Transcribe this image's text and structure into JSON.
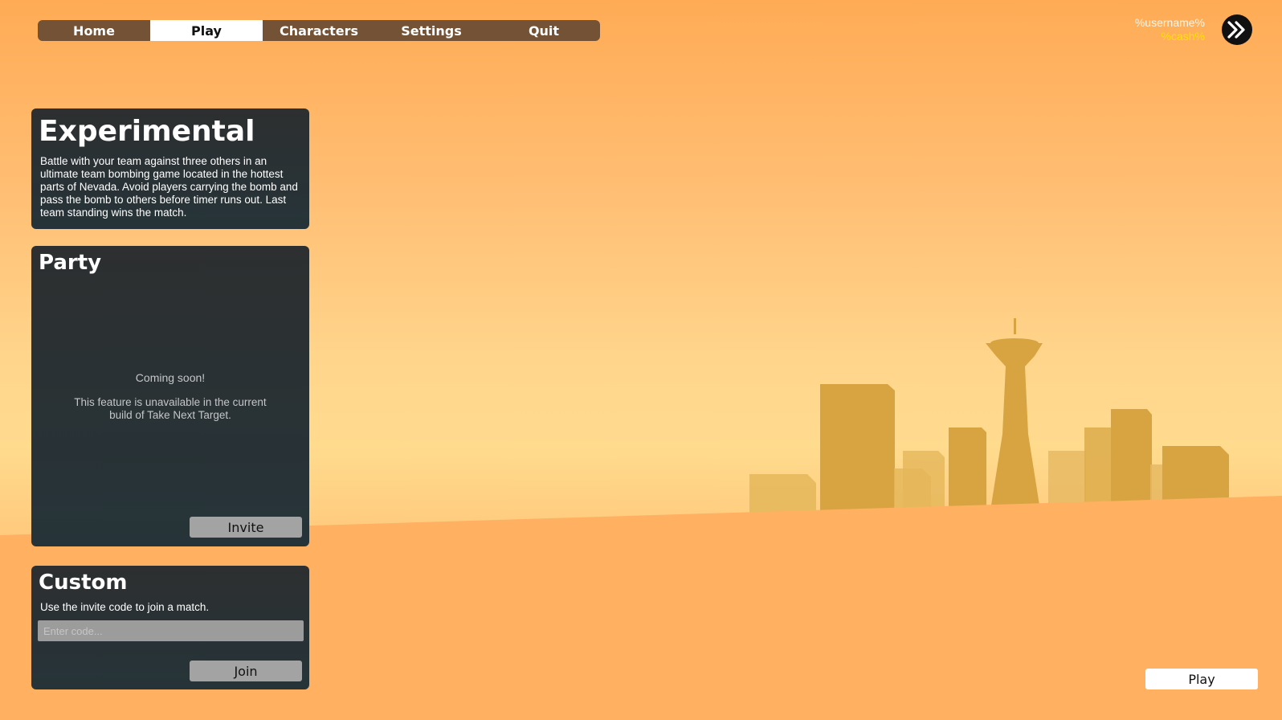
{
  "nav": {
    "items": [
      {
        "label": "Home",
        "active": false
      },
      {
        "label": "Play",
        "active": true
      },
      {
        "label": "Characters",
        "active": false
      },
      {
        "label": "Settings",
        "active": false
      },
      {
        "label": "Quit",
        "active": false
      }
    ]
  },
  "user": {
    "username": "%username%",
    "cash": "%cash%",
    "next_icon": "double-chevron-right-icon"
  },
  "experimental": {
    "title": "Experimental",
    "description": "Battle with your team against three others in an ultimate team bombing game located in the hottest parts of Nevada. Avoid players carrying the bomb and pass the bomb to others before timer runs out. Last team standing wins the match."
  },
  "party": {
    "title": "Party",
    "coming_soon": "Coming soon!",
    "unavailable": "This feature is unavailable in the current build of Take Next Target.",
    "invite_label": "Invite"
  },
  "custom": {
    "title": "Custom",
    "description": "Use the invite code to join a match.",
    "code_placeholder": "Enter code...",
    "code_value": "",
    "join_label": "Join"
  },
  "play_label": "Play",
  "colors": {
    "nav_bg": "#735235",
    "panel_bg": "#2b2f31",
    "cash": "#ffe200",
    "skyline": "#d9a540"
  }
}
